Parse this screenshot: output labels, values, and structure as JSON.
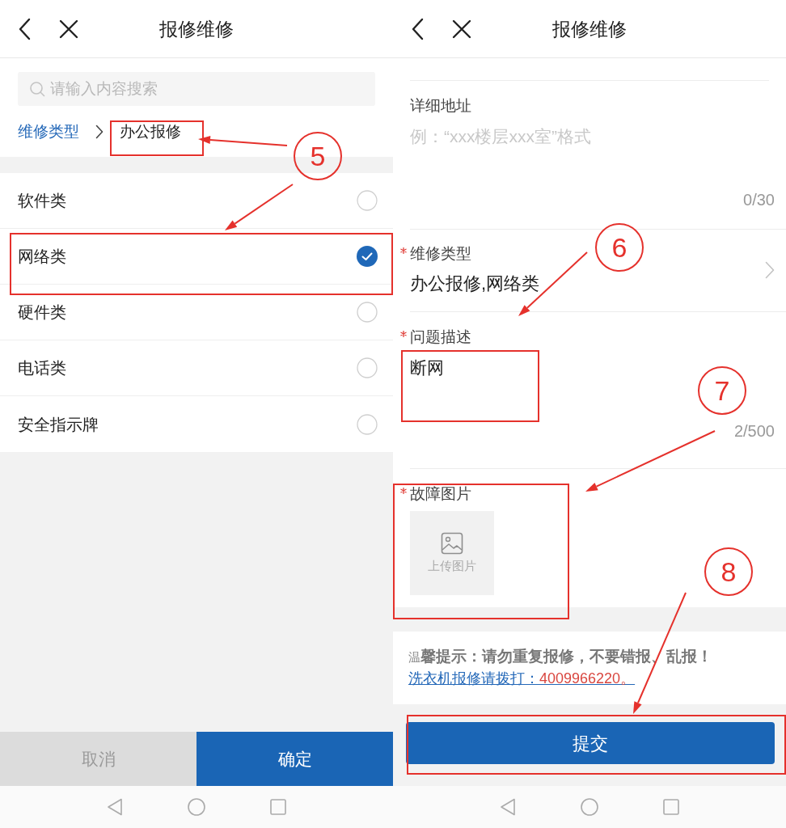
{
  "left_screen": {
    "title": "报修维修",
    "search": {
      "placeholder": "请输入内容搜索"
    },
    "breadcrumb": [
      {
        "label": "维修类型",
        "selected": false
      },
      {
        "label": "办公报修",
        "selected": true
      }
    ],
    "options": [
      {
        "label": "软件类",
        "selected": false
      },
      {
        "label": "网络类",
        "selected": true
      },
      {
        "label": "硬件类",
        "selected": false
      },
      {
        "label": "电话类",
        "selected": false
      },
      {
        "label": "安全指示牌",
        "selected": false
      }
    ],
    "buttons": [
      {
        "label": "取消",
        "kind": "cancel"
      },
      {
        "label": "确定",
        "kind": "confirm"
      }
    ]
  },
  "right_screen": {
    "title": "报修维修",
    "fields": [
      {
        "kind": "textarea",
        "label": "详细地址",
        "required": false,
        "placeholder": "例：“xxx楼层xxx室”格式",
        "counter": "0/30"
      },
      {
        "kind": "select",
        "label": "维修类型",
        "required": true,
        "value": "办公报修,网络类"
      },
      {
        "kind": "textarea",
        "label": "问题描述",
        "required": true,
        "value": "断网",
        "counter": "2/500"
      },
      {
        "kind": "upload",
        "label": "故障图片",
        "required": true,
        "button": "上传图片"
      }
    ],
    "notice": {
      "text": "温**馨提示：请勿重复报修，不要错报、乱报！**",
      "link": "洗衣机报修请拨打：",
      "phone": "4009966220。"
    },
    "submit": "提交"
  },
  "annotations": [
    {
      "label": "5"
    },
    {
      "label": "6"
    },
    {
      "label": "7"
    },
    {
      "label": "8"
    }
  ]
}
